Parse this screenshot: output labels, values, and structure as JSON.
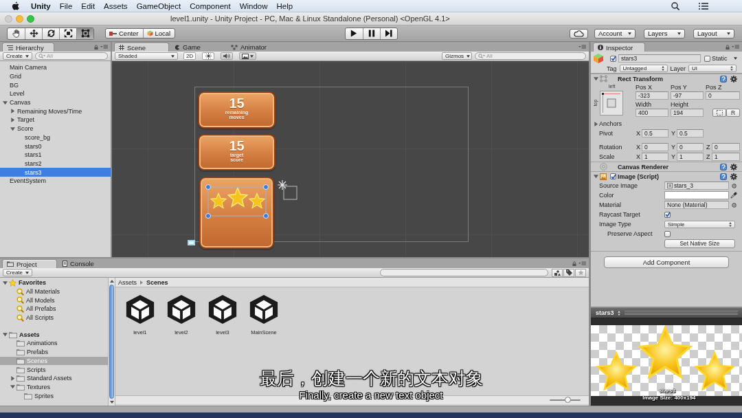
{
  "menubar": {
    "app": "Unity",
    "menus": [
      "File",
      "Edit",
      "Assets",
      "GameObject",
      "Component",
      "Window",
      "Help"
    ]
  },
  "window": {
    "title": "level1.unity - Unity Project - PC, Mac & Linux Standalone (Personal) <OpenGL 4.1>"
  },
  "toolbar": {
    "tools": [
      {
        "kind": "hand",
        "selected": false
      },
      {
        "kind": "move",
        "selected": false
      },
      {
        "kind": "rotate",
        "selected": false
      },
      {
        "kind": "scale",
        "selected": false
      },
      {
        "kind": "rect",
        "selected": true
      }
    ],
    "pivot": [
      {
        "kind": "center",
        "label": "Center"
      },
      {
        "kind": "local",
        "label": "Local"
      }
    ],
    "playback": [
      {
        "kind": "play"
      },
      {
        "kind": "pause"
      },
      {
        "kind": "step"
      }
    ],
    "menus": [
      "Account",
      "Layers",
      "Layout"
    ]
  },
  "hierarchy": {
    "tab": "Hierarchy",
    "create": "Create",
    "search": {
      "placeholder": "All"
    },
    "items": [
      {
        "label": "Main Camera",
        "selected": false
      },
      {
        "label": "Grid",
        "selected": false
      },
      {
        "label": "BG",
        "selected": false
      },
      {
        "label": "Level",
        "selected": false
      },
      {
        "label": "Canvas",
        "selected": false,
        "expanded": true,
        "children": [
          {
            "label": "Remaining Moves/Time",
            "selected": false,
            "expanded": false
          },
          {
            "label": "Target",
            "selected": false,
            "expanded": false
          },
          {
            "label": "Score",
            "selected": false,
            "expanded": true,
            "children": [
              {
                "label": "score_bg",
                "selected": false
              },
              {
                "label": "stars0",
                "selected": false
              },
              {
                "label": "stars1",
                "selected": false
              },
              {
                "label": "stars2",
                "selected": false
              },
              {
                "label": "stars3",
                "selected": true
              }
            ]
          }
        ]
      },
      {
        "label": "EventSystem",
        "selected": false
      }
    ]
  },
  "scene": {
    "tabs": [
      {
        "kind": "scene",
        "label": "Scene",
        "selected": true
      },
      {
        "kind": "game",
        "label": "Game",
        "selected": false
      },
      {
        "kind": "animator",
        "label": "Animator",
        "selected": false
      }
    ],
    "shading": "Shaded",
    "mode_2d": {
      "label": "2D",
      "on": true
    },
    "lighting": {
      "on": true
    },
    "audio": {
      "on": false
    },
    "gizmos": "Gizmos",
    "search": {
      "placeholder": "All"
    },
    "panels": [
      {
        "kind": "counter",
        "number": "15",
        "caption": "remaining moves",
        "selected": false
      },
      {
        "kind": "counter",
        "number": "15",
        "caption": "target score",
        "selected": false
      },
      {
        "kind": "stars",
        "selected": true
      }
    ]
  },
  "inspector": {
    "tab": "Inspector",
    "object": {
      "active": true,
      "name": "stars3",
      "static": false,
      "static_label": "Static",
      "tag_label": "Tag",
      "tag": "Untagged",
      "layer_label": "Layer",
      "layer": "UI"
    },
    "rect_transform": {
      "title": "Rect Transform",
      "expanded": true,
      "anchor_h": "left",
      "anchor_v": "top",
      "position": [
        {
          "label": "Pos X",
          "value": "-323"
        },
        {
          "label": "Pos Y",
          "value": "-97"
        },
        {
          "label": "Pos Z",
          "value": "0"
        }
      ],
      "size": [
        {
          "label": "Width",
          "value": "400"
        },
        {
          "label": "Height",
          "value": "194"
        }
      ],
      "raw_button": "R",
      "anchors": {
        "label": "Anchors",
        "expanded": false
      },
      "vectors": [
        {
          "label": "Pivot",
          "axes": [
            {
              "axis": "X",
              "value": "0.5"
            },
            {
              "axis": "Y",
              "value": "0.5"
            }
          ]
        },
        {
          "label": "Rotation",
          "axes": [
            {
              "axis": "X",
              "value": "0"
            },
            {
              "axis": "Y",
              "value": "0"
            },
            {
              "axis": "Z",
              "value": "0"
            }
          ]
        },
        {
          "label": "Scale",
          "axes": [
            {
              "axis": "X",
              "value": "1"
            },
            {
              "axis": "Y",
              "value": "1"
            },
            {
              "axis": "Z",
              "value": "1"
            }
          ]
        }
      ]
    },
    "canvas_renderer": {
      "title": "Canvas Renderer"
    },
    "image": {
      "title": "Image (Script)",
      "expanded": true,
      "enabled": true,
      "rows": [
        {
          "kind": "sprite",
          "label": "Source Image",
          "value": "stars_3"
        },
        {
          "kind": "color",
          "label": "Color",
          "color": "#ffffff"
        },
        {
          "kind": "object",
          "label": "Material",
          "value": "None (Material)"
        },
        {
          "kind": "checkbox",
          "label": "Raycast Target",
          "checked": true
        },
        {
          "kind": "dropdown",
          "label": "Image Type",
          "value": "Simple",
          "children": [
            {
              "kind": "checkbox",
              "label": "Preserve Aspect",
              "checked": false
            },
            {
              "kind": "button",
              "label": "Set Native Size"
            }
          ]
        }
      ]
    },
    "add_component": "Add Component"
  },
  "project": {
    "tabs": [
      {
        "kind": "project",
        "label": "Project",
        "selected": true
      },
      {
        "kind": "console",
        "label": "Console",
        "selected": false
      }
    ],
    "create": "Create",
    "tree": [
      {
        "kind": "favorites",
        "label": "Favorites",
        "expanded": true,
        "selected": false,
        "children": [
          {
            "kind": "search",
            "label": "All Materials",
            "selected": false
          },
          {
            "kind": "search",
            "label": "All Models",
            "selected": false
          },
          {
            "kind": "search",
            "label": "All Prefabs",
            "selected": false
          },
          {
            "kind": "search",
            "label": "All Scripts",
            "selected": false
          }
        ]
      },
      {
        "kind": "folder",
        "label": "Assets",
        "expanded": true,
        "selected": false,
        "children": [
          {
            "kind": "folder",
            "label": "Animations",
            "selected": false
          },
          {
            "kind": "folder",
            "label": "Prefabs",
            "selected": false
          },
          {
            "kind": "folder",
            "label": "Scenes",
            "selected": true
          },
          {
            "kind": "folder",
            "label": "Scripts",
            "selected": false
          },
          {
            "kind": "folder",
            "label": "Standard Assets",
            "selected": false,
            "expanded": false
          },
          {
            "kind": "folder",
            "label": "Textures",
            "selected": false,
            "expanded": true,
            "children": [
              {
                "kind": "folder",
                "label": "Sprites",
                "selected": false
              }
            ]
          }
        ]
      }
    ],
    "breadcrumb": [
      "Assets",
      "Scenes"
    ],
    "assets": [
      {
        "kind": "scene",
        "name": "level1"
      },
      {
        "kind": "scene",
        "name": "level2"
      },
      {
        "kind": "scene",
        "name": "level3"
      },
      {
        "kind": "scene",
        "name": "MainScene"
      }
    ],
    "icon_size": {
      "level": 0.58
    }
  },
  "preview": {
    "title": "stars3",
    "image_name": "stars3",
    "image_size": "Image Size: 400x194"
  },
  "subtitles": {
    "zh": "最后，创建一个新的文本对象",
    "en": "Finally, create a new text object"
  }
}
